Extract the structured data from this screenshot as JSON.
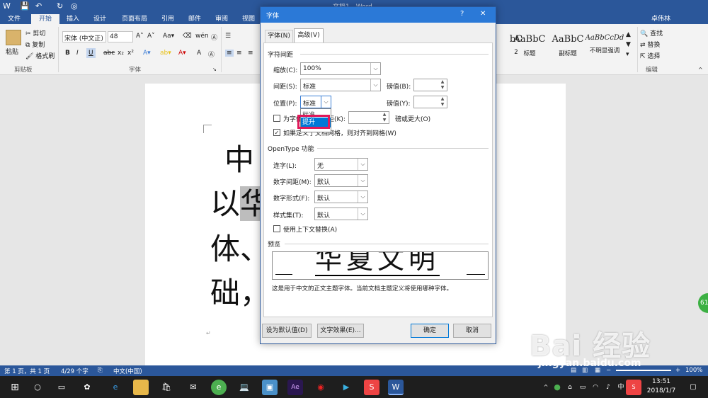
{
  "app": {
    "title": "文档1 - Word",
    "user": "卓伟林"
  },
  "tabs": [
    "文件",
    "开始",
    "插入",
    "设计",
    "页面布局",
    "引用",
    "邮件",
    "审阅",
    "视图"
  ],
  "ribbon": {
    "clipboard": {
      "paste": "粘贴",
      "cut": "剪切",
      "copy": "复制",
      "format_painter": "格式刷",
      "group": "剪贴板"
    },
    "font": {
      "name": "宋体 (中文正)",
      "size": "48",
      "group": "字体"
    },
    "styles": [
      {
        "sample": "AaBbC",
        "name": "标题"
      },
      {
        "sample": "AaBbC",
        "name": "副标题"
      },
      {
        "sample": "AaBbCcDd",
        "name": "不明显强调"
      }
    ],
    "style_partial": "2",
    "edit": {
      "find": "查找",
      "replace": "替换",
      "select": "选择",
      "group": "编辑"
    }
  },
  "document": {
    "lines": [
      "中",
      "以华",
      "体、",
      "础，"
    ]
  },
  "dialog": {
    "title": "字体",
    "help": "?",
    "close": "✕",
    "tabs": [
      "字体(N)",
      "高级(V)"
    ],
    "spacing_header": "字符间距",
    "scale_label": "缩放(C):",
    "scale_value": "100%",
    "spacing_label": "间距(S):",
    "spacing_value": "标准",
    "spacing_pt_label": "磅值(B):",
    "position_label": "位置(P):",
    "position_value": "标准",
    "position_pt_label": "磅值(Y):",
    "dropdown_options": [
      "标准",
      "提升"
    ],
    "kerning_label": "为字体调整字间距(K):",
    "kerning_suffix": "磅或更大(O)",
    "grid_label": "如果定义了文档网格，则对齐到网格(W)",
    "opentype_header": "OpenType 功能",
    "ligature_label": "连字(L):",
    "ligature_value": "无",
    "num_spacing_label": "数字间距(M):",
    "num_spacing_value": "默认",
    "num_form_label": "数字形式(F):",
    "num_form_value": "默认",
    "style_set_label": "样式集(T):",
    "style_set_value": "默认",
    "contextual_label": "使用上下文替换(A)",
    "preview_header": "预览",
    "preview_text": "华夏文明",
    "preview_note": "这是用于中文的正文主题字体。当前文档主题定义将使用哪种字体。",
    "btn_default": "设为默认值(D)",
    "btn_effects": "文字效果(E)...",
    "btn_ok": "确定",
    "btn_cancel": "取消"
  },
  "status": {
    "page": "第 1 页，共 1 页",
    "words": "4/29 个字",
    "lang": "中文(中国)",
    "zoom": "100%"
  },
  "taskbar": {
    "time": "13:51",
    "date": "2018/1/7",
    "ime": "中"
  },
  "watermark": {
    "text": "Bai 经验",
    "url": "jingyan.baidu.com"
  },
  "side_badge": "61",
  "colors": {
    "word_blue": "#2b579a",
    "dialog_title": "#2b79d7",
    "highlight": "#e0195a"
  }
}
